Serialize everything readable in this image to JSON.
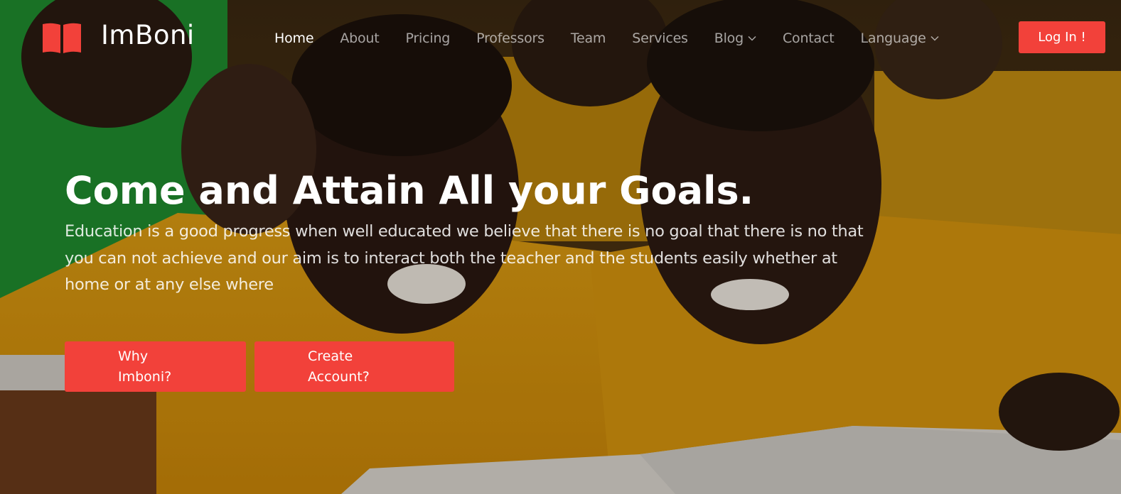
{
  "brand": {
    "name": "ImBoni",
    "icon": "open-book-icon",
    "accent_color": "#f2413a"
  },
  "nav": {
    "items": [
      {
        "label": "Home",
        "active": true
      },
      {
        "label": "About"
      },
      {
        "label": "Pricing"
      },
      {
        "label": "Professors"
      },
      {
        "label": "Team"
      },
      {
        "label": "Services"
      },
      {
        "label": "Blog",
        "has_dropdown": true
      },
      {
        "label": "Contact"
      },
      {
        "label": "Language",
        "has_dropdown": true
      }
    ],
    "login_label": "Log In !"
  },
  "hero": {
    "headline": "Come and Attain All your Goals.",
    "subtitle": "Education is a good progress when well educated we believe that there is no goal that there is no that you can not achieve and our aim is to interact both the teacher and the students easily whether at home or at any else where",
    "buttons": {
      "why": {
        "line1": "Why",
        "line2": "Imboni?"
      },
      "create": {
        "line1": "Create",
        "line2": "Account?"
      }
    }
  }
}
